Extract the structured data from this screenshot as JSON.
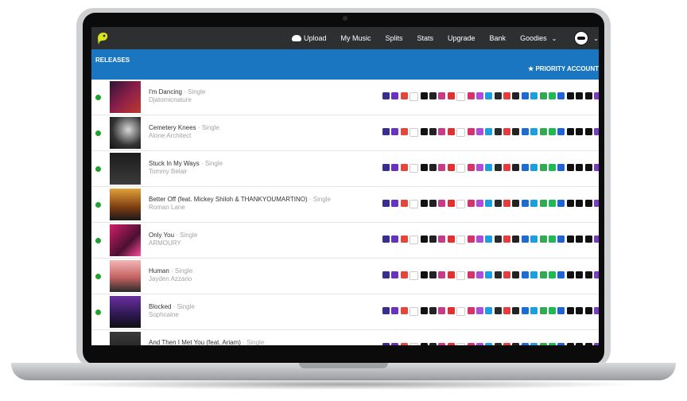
{
  "nav": {
    "upload": "Upload",
    "my_music": "My Music",
    "splits": "Splits",
    "stats": "Stats",
    "upgrade": "Upgrade",
    "bank": "Bank",
    "goodies": "Goodies"
  },
  "releases": {
    "title": "RELEASES",
    "priority": "★ PRIORITY ACCOUNT"
  },
  "rows": [
    {
      "title": "I'm Dancing",
      "type": "· Single",
      "artist": "Djatomicnature"
    },
    {
      "title": "Cemetery Knees",
      "type": "· Single",
      "artist": "Alone Architect"
    },
    {
      "title": "Stuck In My Ways",
      "type": "· Single",
      "artist": "Tommy Belair"
    },
    {
      "title": "Better Off (feat. Mickey Shiloh & THANKYOUMARTINO)",
      "type": "· Single",
      "artist": "Roman Lane"
    },
    {
      "title": "Only You",
      "type": "· Single",
      "artist": "ARMOURY"
    },
    {
      "title": "Human",
      "type": "· Single",
      "artist": "Jayden Azzario"
    },
    {
      "title": "Blocked",
      "type": "· Single",
      "artist": "Sophcaine"
    },
    {
      "title": "And Then I Met You (feat. Ariam)",
      "type": "· Single",
      "artist": ""
    }
  ],
  "colors": {
    "topbar": "#2e2f31",
    "header": "#1a76c1",
    "status_live": "#1fa22e",
    "logo": "#d7e51d"
  },
  "store_icons": [
    "#3a2d8c",
    "#6a31c0",
    "#e8453a",
    "#ffffff",
    "#111111",
    "#222222",
    "#c53c8a",
    "#e03030",
    "#ffffff",
    "#d6336c",
    "#ad4dd8",
    "#1aa0e0",
    "#2a2a2a",
    "#e93b3b",
    "#222222",
    "#1f6bd1",
    "#1aa0e0",
    "#34a853",
    "#1db954",
    "#1f63d6",
    "#111111",
    "#111111",
    "#111111",
    "#7a3cc4",
    "#ff7a00"
  ]
}
